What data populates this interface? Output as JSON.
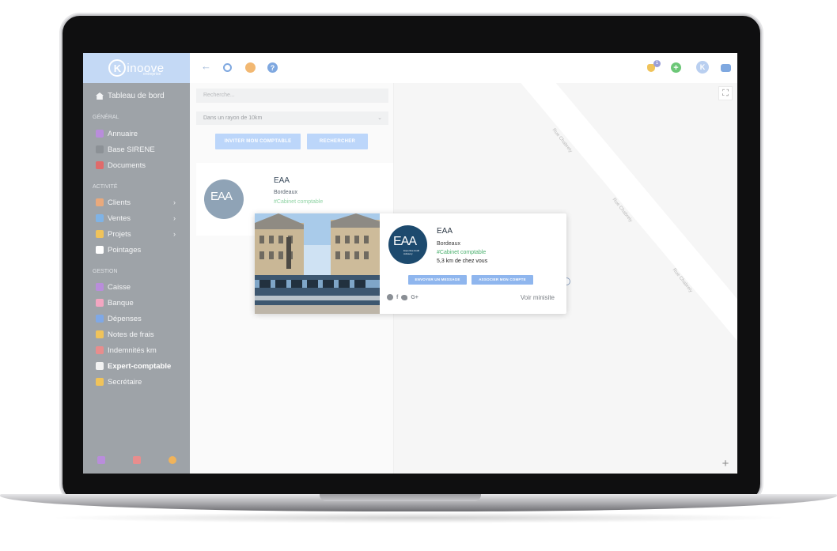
{
  "brand": {
    "logo_letter": "K",
    "logo_text": "inoove",
    "logo_sub": "entreprise"
  },
  "sidebar": {
    "dashboard_label": "Tableau de bord",
    "sections": {
      "general": "GÉNÉRAL",
      "activity": "ACTIVITÉ",
      "management": "GESTION"
    },
    "general_items": [
      {
        "label": "Annuaire",
        "icon": "book-icon",
        "color": "#b98ddb"
      },
      {
        "label": "Base SIRENE",
        "icon": "database-icon",
        "color": "#8c9196"
      },
      {
        "label": "Documents",
        "icon": "folder-icon",
        "color": "#e06b6b"
      }
    ],
    "activity_items": [
      {
        "label": "Clients",
        "icon": "users-icon",
        "color": "#e9a97c",
        "chevron": "›"
      },
      {
        "label": "Ventes",
        "icon": "file-icon",
        "color": "#7fb3e6",
        "chevron": "›"
      },
      {
        "label": "Projets",
        "icon": "blocks-icon",
        "color": "#f0c35a",
        "chevron": "›"
      },
      {
        "label": "Pointages",
        "icon": "stopwatch-icon",
        "color": "#ffffff"
      }
    ],
    "management_items": [
      {
        "label": "Caisse",
        "icon": "cash-register-icon",
        "color": "#b98ddb"
      },
      {
        "label": "Banque",
        "icon": "piggy-bank-icon",
        "color": "#f3a6c1"
      },
      {
        "label": "Dépenses",
        "icon": "receipt-icon",
        "color": "#7fa8e6"
      },
      {
        "label": "Notes de frais",
        "icon": "hand-money-icon",
        "color": "#f0c35a"
      },
      {
        "label": "Indemnités km",
        "icon": "car-icon",
        "color": "#e88d8d"
      },
      {
        "label": "Expert-comptable",
        "icon": "accountant-icon",
        "color": "#f2f2f2",
        "active": true
      },
      {
        "label": "Secrétaire",
        "icon": "handshake-icon",
        "color": "#f0c35a"
      }
    ],
    "footer_icons": [
      "calculator-icon",
      "excel-icon",
      "gears-icon"
    ]
  },
  "topbar": {
    "notification_count": "1",
    "avatar_letter": "K"
  },
  "search": {
    "placeholder": "Recherche...",
    "radius_value": "Dans un rayon de 10km",
    "invite_label": "INVITER MON COMPTABLE",
    "search_label": "RECHERCHER"
  },
  "result": {
    "name": "EAA",
    "city": "Bordeaux",
    "tag": "#Cabinet comptable"
  },
  "map": {
    "street_labels": [
      "Rue Chabrely",
      "Rue Chabrely",
      "Rue Chabrely"
    ]
  },
  "popup": {
    "name": "EAA",
    "city": "Bordeaux",
    "tag": "#Cabinet comptable",
    "distance": "5,3 km de chez vous",
    "message_label": "ENVOYER UN MESSAGE",
    "associate_label": "ASSOCIER MON COMPTE",
    "social": [
      "globe-icon",
      "f",
      "twitter-icon",
      "G+"
    ],
    "link_label": "Voir minisite",
    "logo_text": "EAA",
    "logo_sub": "Expertise Audit Advisory"
  },
  "colors": {
    "sidebar_bg": "#9ea3a8",
    "logo_bg": "#c4d9f5",
    "accent_blue": "#8fb6ee",
    "tag_green": "#4ab06e"
  }
}
